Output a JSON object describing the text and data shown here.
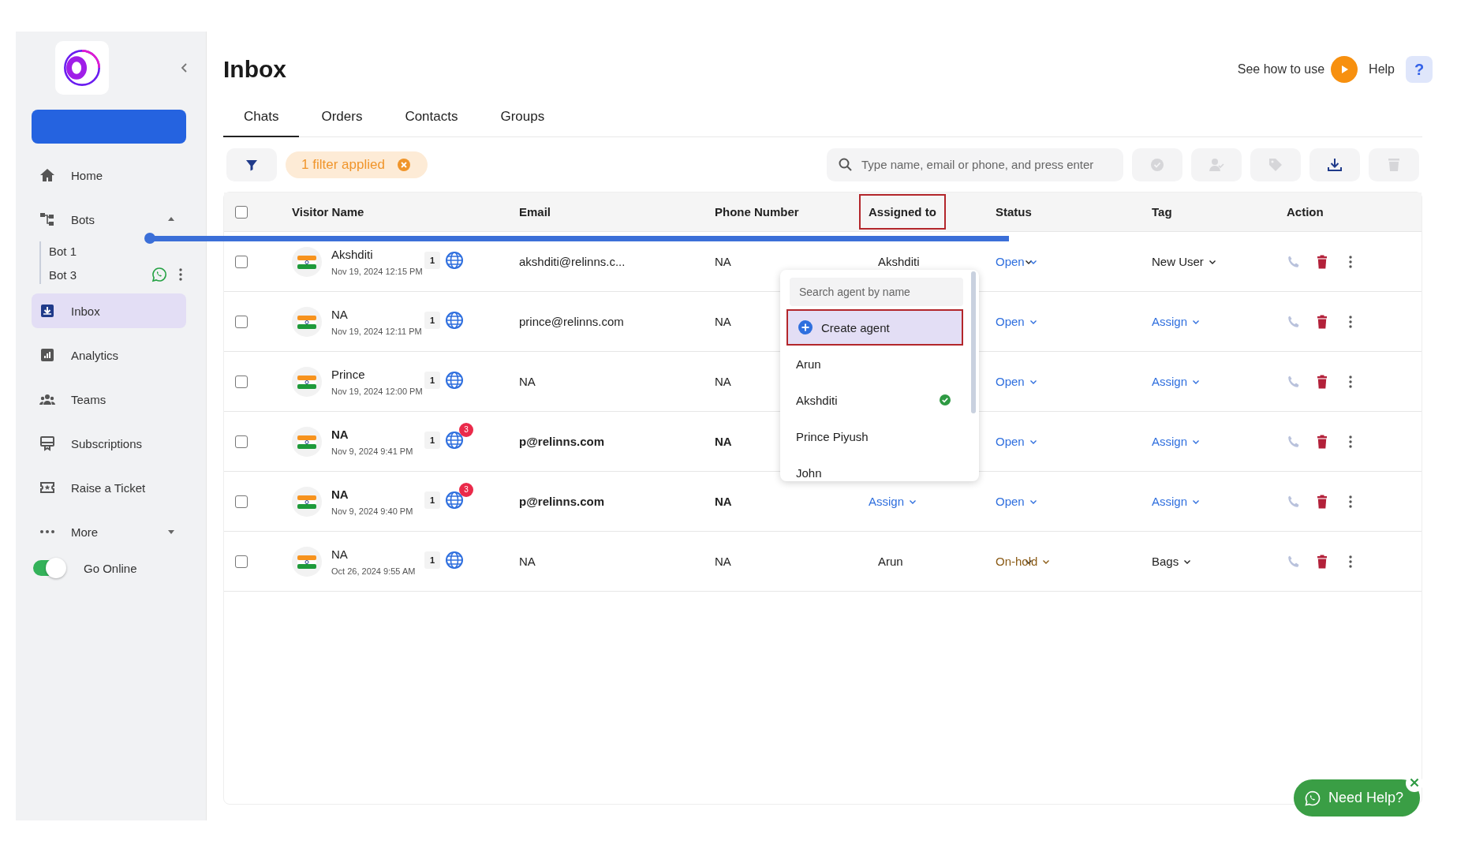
{
  "sidebar": {
    "nav": [
      {
        "kind": "link",
        "label": "Home",
        "selected": false
      },
      {
        "kind": "group",
        "label": "Bots",
        "expanded": true,
        "children": [
          {
            "label": "Bot 1",
            "kind": "plain"
          },
          {
            "label": "Bot 3",
            "kind": "whatsapp"
          }
        ]
      },
      {
        "kind": "link",
        "label": "Inbox",
        "selected": true
      },
      {
        "kind": "link",
        "label": "Analytics",
        "selected": false
      },
      {
        "kind": "link",
        "label": "Teams",
        "selected": false
      },
      {
        "kind": "link",
        "label": "Subscriptions",
        "selected": false
      },
      {
        "kind": "link",
        "label": "Raise a Ticket",
        "selected": false
      },
      {
        "kind": "group",
        "label": "More",
        "expanded": false
      }
    ],
    "online": {
      "label": "Go Online",
      "on": true
    }
  },
  "header": {
    "title": "Inbox",
    "guide": "See how to use",
    "help": "Help",
    "help_icon": "?"
  },
  "tabs": [
    {
      "label": "Chats",
      "selected": true
    },
    {
      "label": "Orders",
      "selected": false
    },
    {
      "label": "Contacts",
      "selected": false
    },
    {
      "label": "Groups",
      "selected": false
    }
  ],
  "toolbar": {
    "filter_chip": "1 filter applied",
    "search": {
      "placeholder": "Type name, email or phone, and press enter"
    },
    "actions": [
      {
        "kind": "resolve",
        "disabled": true
      },
      {
        "kind": "assign",
        "disabled": true
      },
      {
        "kind": "tag",
        "disabled": true
      },
      {
        "kind": "download",
        "disabled": false
      },
      {
        "kind": "delete",
        "disabled": true
      }
    ]
  },
  "table": {
    "all_checked": false,
    "columns": [
      {
        "label": "Visitor Name",
        "highlighted": false
      },
      {
        "label": "Email",
        "highlighted": false
      },
      {
        "label": "Phone Number",
        "highlighted": false
      },
      {
        "label": "Assigned to",
        "highlighted": true
      },
      {
        "label": "Status",
        "highlighted": false
      },
      {
        "label": "Tag",
        "highlighted": false
      },
      {
        "label": "Action",
        "highlighted": false
      }
    ],
    "rows": [
      {
        "checked": false,
        "unread": false,
        "name": "Akshditi",
        "time": "Nov 19, 2024 12:15 PM",
        "count": "1",
        "email": "akshditi@relinns.c...",
        "phone": "NA",
        "assigned": {
          "text": "Akshditi",
          "kind": "agent"
        },
        "status": {
          "text": "Open",
          "kind": "open"
        },
        "tag": {
          "text": "New User",
          "kind": "value"
        }
      },
      {
        "checked": false,
        "unread": false,
        "name": "NA",
        "time": "Nov 19, 2024 12:11 PM",
        "count": "1",
        "email": "prince@relinns.com",
        "phone": "NA",
        "status": {
          "text": "Open",
          "kind": "open"
        },
        "tag": {
          "text": "Assign",
          "kind": "prompt"
        }
      },
      {
        "checked": false,
        "unread": false,
        "name": "Prince",
        "time": "Nov 19, 2024 12:00 PM",
        "count": "1",
        "email": "NA",
        "phone": "NA",
        "status": {
          "text": "Open",
          "kind": "open"
        },
        "tag": {
          "text": "Assign",
          "kind": "prompt"
        }
      },
      {
        "checked": false,
        "unread": true,
        "name": "NA",
        "time": "Nov 9, 2024 9:41 PM",
        "count": "1",
        "badge": "3",
        "email": "p@relinns.com",
        "phone": "NA",
        "status": {
          "text": "Open",
          "kind": "open"
        },
        "tag": {
          "text": "Assign",
          "kind": "prompt"
        }
      },
      {
        "checked": false,
        "unread": true,
        "name": "NA",
        "time": "Nov 9, 2024 9:40 PM",
        "count": "1",
        "badge": "3",
        "email": "p@relinns.com",
        "phone": "NA",
        "assigned": {
          "text": "Assign",
          "kind": "prompt"
        },
        "status": {
          "text": "Open",
          "kind": "open"
        },
        "tag": {
          "text": "Assign",
          "kind": "prompt"
        }
      },
      {
        "checked": false,
        "unread": false,
        "name": "NA",
        "time": "Oct 26, 2024 9:55 AM",
        "count": "1",
        "email": "NA",
        "phone": "NA",
        "assigned": {
          "text": "Arun",
          "kind": "agent"
        },
        "status": {
          "text": "On-hold",
          "kind": "onhold"
        },
        "tag": {
          "text": "Bags",
          "kind": "value"
        }
      }
    ]
  },
  "agent_menu": {
    "search": {
      "placeholder": "Search agent by name"
    },
    "create": {
      "label": "Create agent",
      "highlighted": true
    },
    "agents": [
      {
        "name": "Arun",
        "selected": false
      },
      {
        "name": "Akshditi",
        "selected": true
      },
      {
        "name": "Prince Piyush",
        "selected": false
      },
      {
        "name": "John",
        "selected": false
      }
    ]
  },
  "help_widget": {
    "label": "Need Help?"
  }
}
